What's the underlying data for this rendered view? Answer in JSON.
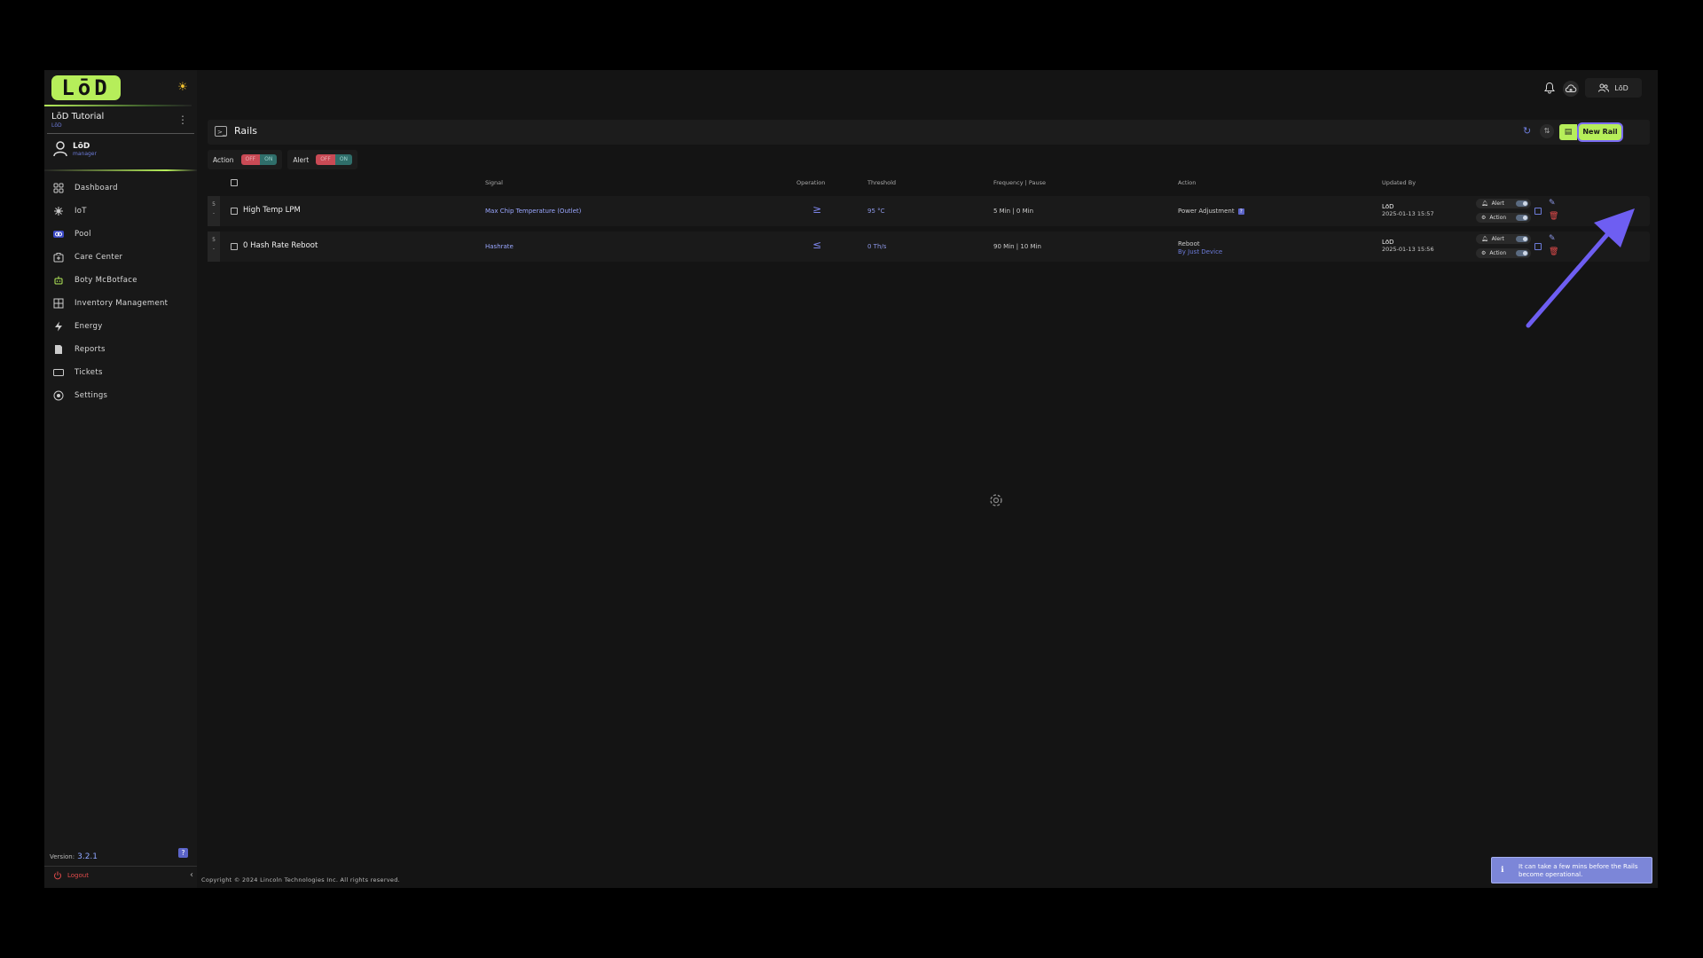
{
  "app": {
    "logo_text": "LōD",
    "workspace": {
      "name": "LōD Tutorial",
      "sub": "LōD"
    },
    "user": {
      "name": "LōD",
      "role": "manager"
    },
    "version_label": "Version:",
    "version": "3.2.1",
    "help_label": "?",
    "logout_label": "Logout",
    "collapse_label": "‹"
  },
  "sidebar": {
    "items": [
      {
        "label": "Dashboard",
        "icon": "dashboard-icon"
      },
      {
        "label": "IoT",
        "icon": "iot-icon"
      },
      {
        "label": "Pool",
        "icon": "pool-icon"
      },
      {
        "label": "Care Center",
        "icon": "care-center-icon"
      },
      {
        "label": "Boty McBotface",
        "icon": "bot-icon"
      },
      {
        "label": "Inventory Management",
        "icon": "inventory-icon"
      },
      {
        "label": "Energy",
        "icon": "energy-icon"
      },
      {
        "label": "Reports",
        "icon": "reports-icon"
      },
      {
        "label": "Tickets",
        "icon": "tickets-icon"
      },
      {
        "label": "Settings",
        "icon": "settings-icon"
      }
    ]
  },
  "topbar": {
    "user_label": "LōD"
  },
  "page": {
    "title": "Rails",
    "new_button": "New Rail",
    "filters": [
      {
        "label": "Action",
        "off": "OFF",
        "on": "ON"
      },
      {
        "label": "Alert",
        "off": "OFF",
        "on": "ON"
      }
    ]
  },
  "table": {
    "columns": {
      "signal": "Signal",
      "operation": "Operation",
      "threshold": "Threshold",
      "frequency": "Frequency | Pause",
      "action": "Action",
      "updated_by": "Updated By"
    },
    "rows": [
      {
        "priority": "5",
        "priority_sub": "-",
        "name": "High Temp LPM",
        "signal": "Max Chip Temperature (Outlet)",
        "operation": "≥",
        "threshold": "95 °C",
        "frequency": "5 Min | 0 Min",
        "action": "Power Adjustment",
        "action_tag": "?",
        "action_sub": "",
        "updated_name": "LōD",
        "updated_time": "2025-01-13 15:57",
        "alert_label": "Alert",
        "action_toggle_label": "Action"
      },
      {
        "priority": "5",
        "priority_sub": "-",
        "name": "0 Hash Rate Reboot",
        "signal": "Hashrate",
        "operation": "≤",
        "threshold": "0 Th/s",
        "frequency": "90 Min | 10 Min",
        "action": "Reboot",
        "action_tag": "",
        "action_sub": "By Just Device",
        "updated_name": "LōD",
        "updated_time": "2025-01-13 15:56",
        "alert_label": "Alert",
        "action_toggle_label": "Action"
      }
    ]
  },
  "footer": {
    "copyright": "Copyright © 2024 Lincoln Technologies Inc. All rights reserved."
  },
  "toast": {
    "text": "It can take a few mins before the Rails become operational.",
    "icon": "info-icon"
  },
  "colors": {
    "accent": "#b6ee5a",
    "link": "#9aa7ff",
    "danger": "#e04b4b",
    "annotation": "#7b6cf5"
  }
}
